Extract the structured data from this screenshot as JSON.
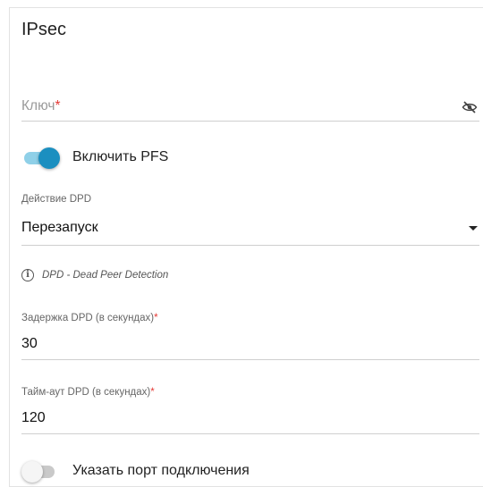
{
  "section": {
    "title": "IPsec"
  },
  "key": {
    "label": "Ключ",
    "required_mark": "*",
    "visibility_icon": "eye-off-icon"
  },
  "pfs": {
    "label": "Включить PFS",
    "enabled": true
  },
  "dpd_action": {
    "label": "Действие DPD",
    "value": "Перезапуск",
    "icon": "caret-down-icon"
  },
  "dpd_info": {
    "icon": "info-icon",
    "glyph": "i",
    "text": "DPD - Dead Peer Detection"
  },
  "dpd_delay": {
    "label": "Задержка DPD (в секундах)",
    "required_mark": "*",
    "value": "30"
  },
  "dpd_timeout": {
    "label": "Тайм-аут DPD (в секундах)",
    "required_mark": "*",
    "value": "120"
  },
  "port": {
    "label": "Указать порт подключения",
    "enabled": false
  },
  "colors": {
    "accent": "#1b8fc0",
    "accent_track": "#8fd0e8",
    "required": "#e53935"
  }
}
